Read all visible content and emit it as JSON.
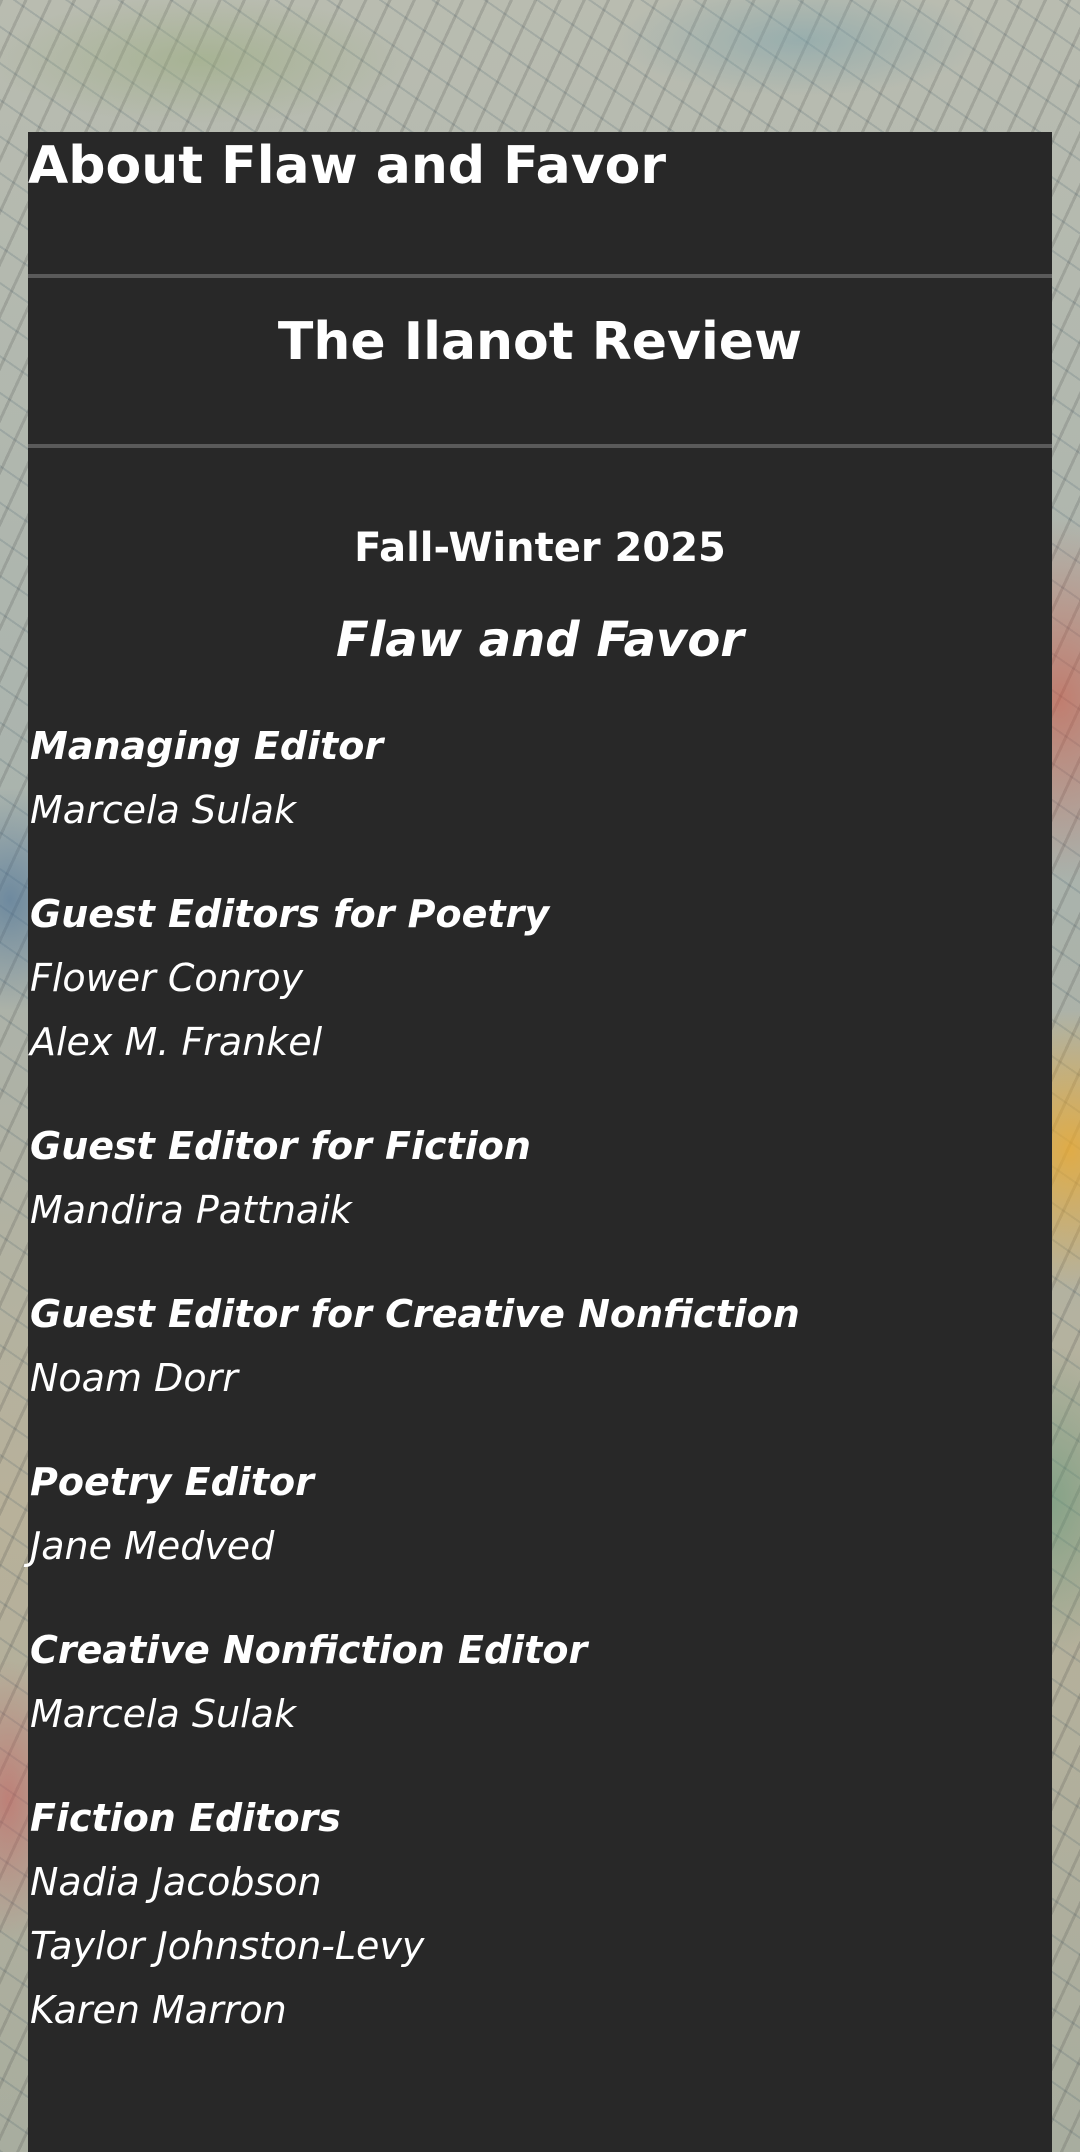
{
  "page_title": "About Flaw and Favor",
  "journal_name": "The Ilanot Review",
  "issue": "Fall-Winter 2025",
  "theme": "Flaw and Favor",
  "masthead": [
    {
      "role": "Managing Editor",
      "people": [
        "Marcela Sulak"
      ]
    },
    {
      "role": "Guest Editors for Poetry",
      "people": [
        "Flower Conroy",
        "Alex M. Frankel"
      ]
    },
    {
      "role": "Guest Editor for Fiction",
      "people": [
        "Mandira Pattnaik"
      ]
    },
    {
      "role": "Guest Editor for Creative Nonfiction",
      "people": [
        "Noam Dorr"
      ]
    },
    {
      "role": "Poetry Editor",
      "people": [
        "Jane Medved"
      ]
    },
    {
      "role": "Creative Nonfiction Editor",
      "people": [
        "Marcela Sulak"
      ]
    },
    {
      "role": "Fiction Editors",
      "people": [
        "Nadia Jacobson",
        "Taylor Johnston-Levy",
        "Karen Marron"
      ]
    }
  ]
}
